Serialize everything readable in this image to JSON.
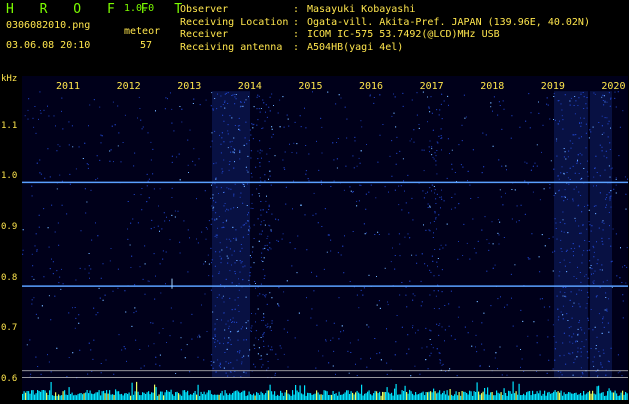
{
  "app": {
    "name": "H R O F F T",
    "version": "1.0.0"
  },
  "file_name": "0306082010.png",
  "meteor": {
    "label": "meteor",
    "count": "57"
  },
  "timestamp": "03.06.08 20:10",
  "info": [
    {
      "label": "Observer",
      "sep": ":",
      "value": "Masayuki Kobayashi"
    },
    {
      "label": "Receiving Location",
      "sep": ":",
      "value": "Ogata-vill. Akita-Pref. JAPAN (139.96E, 40.02N)"
    },
    {
      "label": "Receiver",
      "sep": ":",
      "value": "ICOM IC-575 53.7492(@LCD)MHz USB"
    },
    {
      "label": "Receiving antenna",
      "sep": ":",
      "value": "A504HB(yagi 4el)"
    }
  ],
  "chart_data": {
    "type": "heatmap",
    "ylabel": "kHz",
    "yticks": [
      "1.1",
      "1.0",
      "0.9",
      "0.8",
      "0.7",
      "0.6"
    ],
    "xticks": [
      "2011",
      "2012",
      "2013",
      "2014",
      "2015",
      "2016",
      "2017",
      "2018",
      "2019",
      "2020"
    ],
    "y_range": [
      0.58,
      1.2
    ],
    "carrier_lines_khz": [
      0.99,
      0.785
    ],
    "colors": {
      "background": "#000000",
      "text": "#ffe64d",
      "title": "#7cfc00",
      "carrier": "#5aa0ff",
      "histogram": "#00e5ff"
    }
  }
}
